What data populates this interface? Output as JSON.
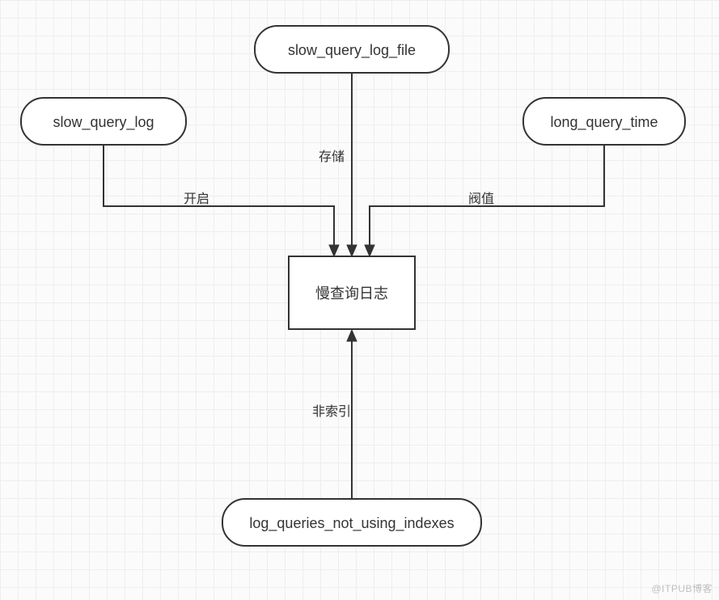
{
  "diagram": {
    "center": {
      "label": "慢查询日志"
    },
    "nodes": {
      "slow_query_log": {
        "label": "slow_query_log"
      },
      "slow_query_log_file": {
        "label": "slow_query_log_file"
      },
      "long_query_time": {
        "label": "long_query_time"
      },
      "log_queries_not_using_indexes": {
        "label": "log_queries_not_using_indexes"
      }
    },
    "edges": {
      "enable": {
        "label": "开启"
      },
      "storage": {
        "label": "存储"
      },
      "threshold": {
        "label": "阀值"
      },
      "notindex": {
        "label": "非索引"
      }
    }
  },
  "watermark": "@ITPUB博客"
}
